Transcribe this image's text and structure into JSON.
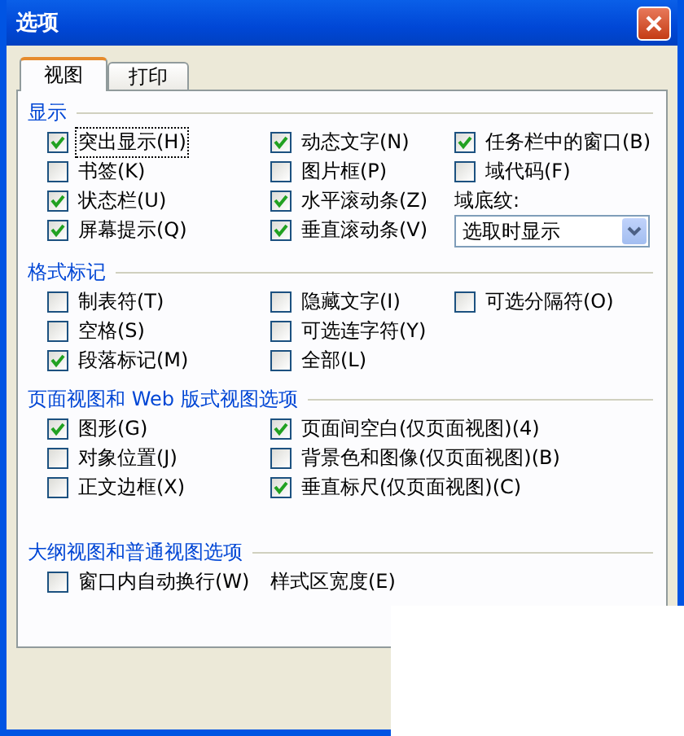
{
  "window": {
    "title": "选项"
  },
  "tabs": [
    {
      "label": "视图",
      "selected": true
    },
    {
      "label": "打印",
      "selected": false
    }
  ],
  "sections": [
    {
      "title": "显示",
      "rows": [
        [
          {
            "kind": "checkbox",
            "label": "突出显示(H)",
            "checked": true,
            "focused": true
          },
          {
            "kind": "checkbox",
            "label": "动态文字(N)",
            "checked": true,
            "focused": false
          },
          {
            "kind": "checkbox",
            "label": "任务栏中的窗口(B)",
            "checked": true,
            "focused": false
          }
        ],
        [
          {
            "kind": "checkbox",
            "label": "书签(K)",
            "checked": false,
            "focused": false
          },
          {
            "kind": "checkbox",
            "label": "图片框(P)",
            "checked": false,
            "focused": false
          },
          {
            "kind": "checkbox",
            "label": "域代码(F)",
            "checked": false,
            "focused": false
          }
        ],
        [
          {
            "kind": "checkbox",
            "label": "状态栏(U)",
            "checked": true,
            "focused": false
          },
          {
            "kind": "checkbox",
            "label": "水平滚动条(Z)",
            "checked": true,
            "focused": false
          },
          {
            "kind": "label",
            "label": "域底纹:"
          }
        ],
        [
          {
            "kind": "checkbox",
            "label": "屏幕提示(Q)",
            "checked": true,
            "focused": false
          },
          {
            "kind": "checkbox",
            "label": "垂直滚动条(V)",
            "checked": true,
            "focused": false
          },
          {
            "kind": "dropdown",
            "value": "选取时显示"
          }
        ]
      ]
    },
    {
      "title": "格式标记",
      "rows": [
        [
          {
            "kind": "checkbox",
            "label": "制表符(T)",
            "checked": false,
            "focused": false
          },
          {
            "kind": "checkbox",
            "label": "隐藏文字(I)",
            "checked": false,
            "focused": false
          },
          {
            "kind": "checkbox",
            "label": "可选分隔符(O)",
            "checked": false,
            "focused": false
          }
        ],
        [
          {
            "kind": "checkbox",
            "label": "空格(S)",
            "checked": false,
            "focused": false
          },
          {
            "kind": "checkbox",
            "label": "可选连字符(Y)",
            "checked": false,
            "focused": false
          }
        ],
        [
          {
            "kind": "checkbox",
            "label": "段落标记(M)",
            "checked": true,
            "focused": false
          },
          {
            "kind": "checkbox",
            "label": "全部(L)",
            "checked": false,
            "focused": false
          }
        ]
      ]
    },
    {
      "title": "页面视图和 Web 版式视图选项",
      "rows": [
        [
          {
            "kind": "checkbox",
            "label": "图形(G)",
            "checked": true,
            "focused": false
          },
          {
            "kind": "checkbox",
            "label": "页面间空白(仅页面视图)(4)",
            "checked": true,
            "focused": false
          }
        ],
        [
          {
            "kind": "checkbox",
            "label": "对象位置(J)",
            "checked": false,
            "focused": false
          },
          {
            "kind": "checkbox",
            "label": "背景色和图像(仅页面视图)(B)",
            "checked": false,
            "focused": false
          }
        ],
        [
          {
            "kind": "checkbox",
            "label": "正文边框(X)",
            "checked": false,
            "focused": false
          },
          {
            "kind": "checkbox",
            "label": "垂直标尺(仅页面视图)(C)",
            "checked": true,
            "focused": false
          }
        ]
      ]
    },
    {
      "title": "大纲视图和普通视图选项",
      "rows": [
        [
          {
            "kind": "checkbox",
            "label": "窗口内自动换行(W)",
            "checked": false,
            "focused": false
          },
          {
            "kind": "label",
            "label": "样式区宽度(E)"
          }
        ]
      ]
    }
  ]
}
